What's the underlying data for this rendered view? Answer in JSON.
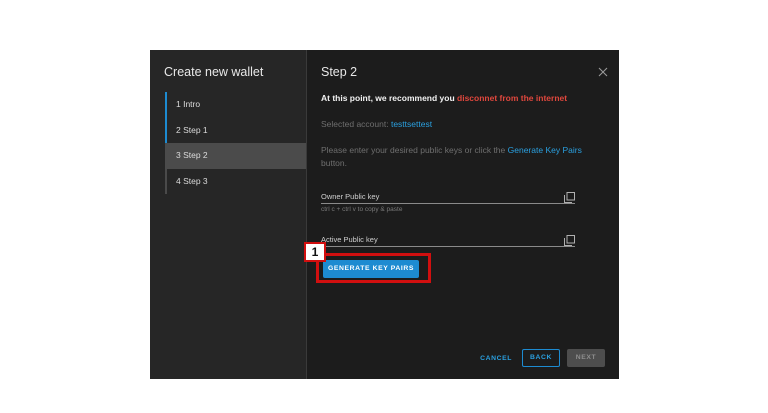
{
  "sidebar": {
    "title": "Create new wallet",
    "steps": [
      {
        "label": "1 Intro",
        "state": "done"
      },
      {
        "label": "2 Step 1",
        "state": "done"
      },
      {
        "label": "3 Step 2",
        "state": "active"
      },
      {
        "label": "4 Step 3",
        "state": "pending"
      }
    ]
  },
  "main": {
    "title": "Step 2",
    "recommend_text": "At this point, we recommend you",
    "recommend_warning": "disconnet from the internet",
    "selected_label": "Selected account:",
    "selected_account": "testtsettest",
    "instructions_prefix": "Please enter your desired public keys or click the",
    "instructions_link": "Generate Key Pairs",
    "instructions_suffix": "button.",
    "owner_key_placeholder": "Owner Public key",
    "owner_key_value": "",
    "copy_hint": "ctrl c + ctrl v to copy & paste",
    "active_key_placeholder": "Active Public key",
    "active_key_value": "",
    "generate_button": "GENERATE KEY PAIRS"
  },
  "footer": {
    "cancel_label": "CANCEL",
    "back_label": "BACK",
    "next_label": "NEXT"
  },
  "annotation": {
    "badge_number": "1"
  },
  "icons": {
    "close": "close-icon",
    "copy": "copy-icon"
  },
  "colors": {
    "accent": "#1d8bd1",
    "warning": "#e0473d",
    "callout": "#d10f0f"
  }
}
